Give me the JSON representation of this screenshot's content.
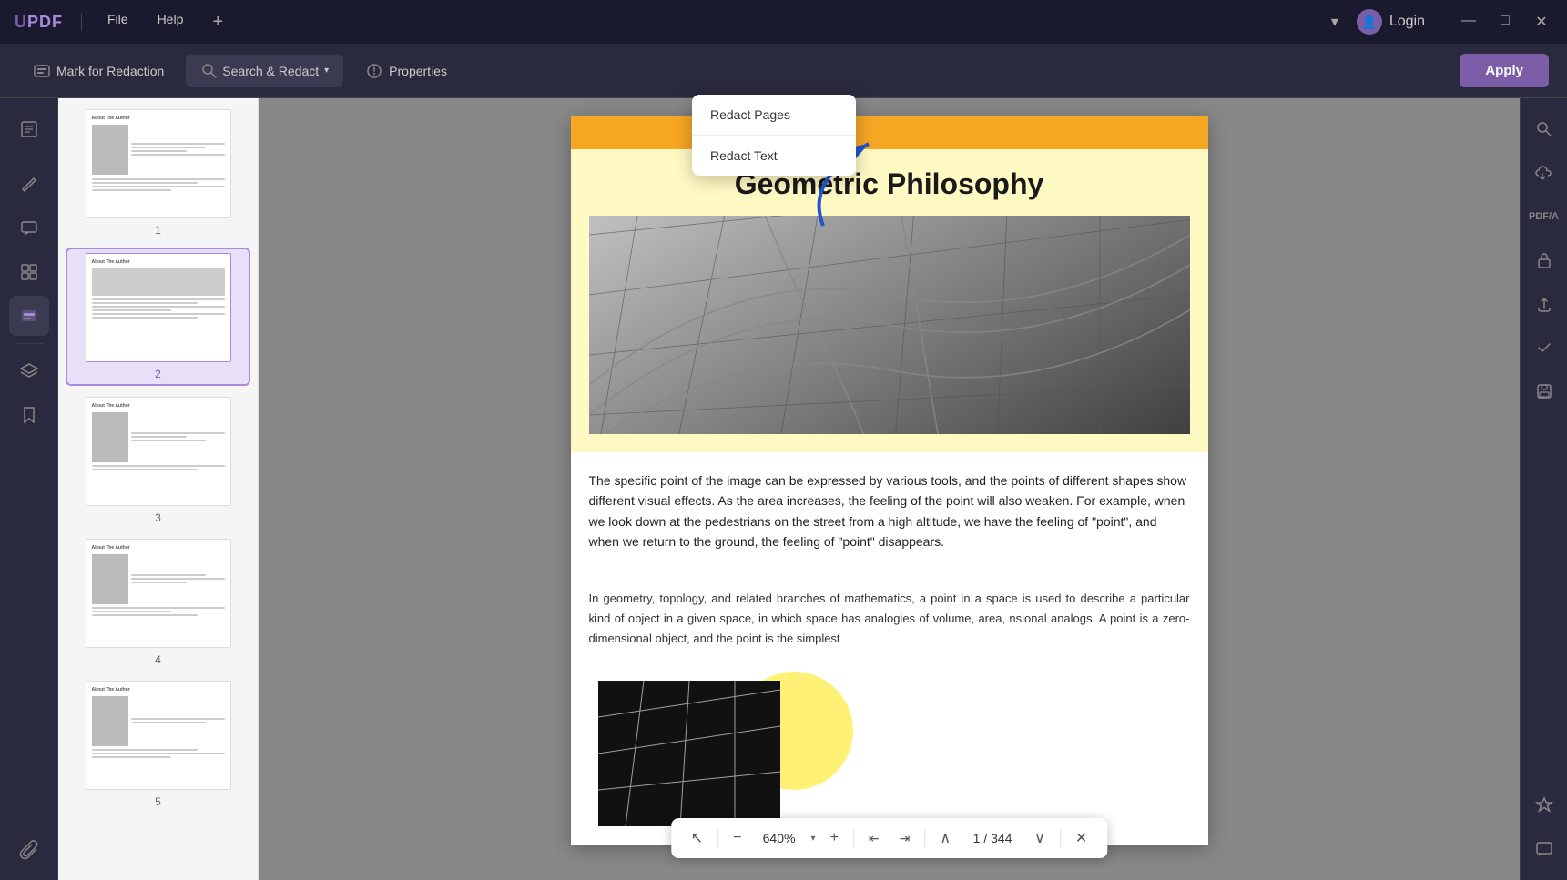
{
  "app": {
    "logo": "UPDF",
    "divider": "|",
    "menu": {
      "file": "File",
      "help": "Help",
      "add": "+"
    },
    "login": "Login",
    "window_controls": {
      "minimize": "—",
      "maximize": "□",
      "close": "✕"
    }
  },
  "toolbar": {
    "mark_for_redaction": "Mark for Redaction",
    "search_and_redact": "Search & Redact",
    "properties": "Properties",
    "apply": "Apply"
  },
  "dropdown": {
    "redact_pages": "Redact Pages",
    "redact_text": "Redact Text"
  },
  "sidebar": {
    "icons": [
      {
        "name": "reader-icon",
        "symbol": "📖",
        "active": false
      },
      {
        "name": "edit-icon",
        "symbol": "✏️",
        "active": false
      },
      {
        "name": "comment-icon",
        "symbol": "💬",
        "active": false
      },
      {
        "name": "layout-icon",
        "symbol": "⊞",
        "active": false
      },
      {
        "name": "redact-icon",
        "symbol": "■",
        "active": true
      },
      {
        "name": "layers-icon",
        "symbol": "⊕",
        "active": false
      },
      {
        "name": "bookmark-icon",
        "symbol": "🔖",
        "active": false
      },
      {
        "name": "attachment-icon",
        "symbol": "📎",
        "active": false
      }
    ]
  },
  "thumbnails": [
    {
      "page_num": "1",
      "selected": false
    },
    {
      "page_num": "2",
      "selected": true
    },
    {
      "page_num": "3",
      "selected": false
    },
    {
      "page_num": "4",
      "selected": false
    },
    {
      "page_num": "5",
      "selected": false
    }
  ],
  "pdf_content": {
    "title": "Geometric Philosophy",
    "body_text": "The specific point of the image can be expressed by various tools, and the points of different shapes show different visual effects. As the area increases, the feeling of the point will also weaken. For example, when we look down at the pedestrians on the street from a high altitude, we have the feeling of \"point\", and when we return to the ground, the feeling of \"point\" disappears.",
    "footer_text": "In geometry, topology, and related branches of mathematics, a point in a space is used to describe a particular kind of object in a given space, in which space has analogies of volume, area, nsional analogs. A point is a zero-dimensional object, and the point is the simplest"
  },
  "bottom_toolbar": {
    "zoom": "640%",
    "page_current": "1",
    "page_total": "344",
    "zoom_in": "+",
    "zoom_out": "−",
    "fit_page": "⤢",
    "fit_width": "⤡",
    "prev_page": "∧",
    "next_page": "∨",
    "close": "✕",
    "cursor_icon": "↖"
  },
  "right_sidebar": {
    "icons": [
      {
        "name": "search-right-icon",
        "symbol": "🔍"
      },
      {
        "name": "save-cloud-icon",
        "symbol": "☁"
      },
      {
        "name": "pdf-a-icon",
        "symbol": "A"
      },
      {
        "name": "lock-icon",
        "symbol": "🔒"
      },
      {
        "name": "upload-icon",
        "symbol": "↑"
      },
      {
        "name": "check-icon",
        "symbol": "✓"
      },
      {
        "name": "save-icon",
        "symbol": "💾"
      },
      {
        "name": "star-icon",
        "symbol": "✦"
      },
      {
        "name": "chat-icon",
        "symbol": "💬"
      }
    ]
  },
  "colors": {
    "accent": "#7b5ea7",
    "toolbar_bg": "#2a2a3e",
    "title_bar_bg": "#1a1a2e",
    "apply_btn": "#7b5ea7",
    "dropdown_bg": "#ffffff",
    "page_accent": "#f5a623",
    "page_bg_yellow": "#fff9c4"
  }
}
